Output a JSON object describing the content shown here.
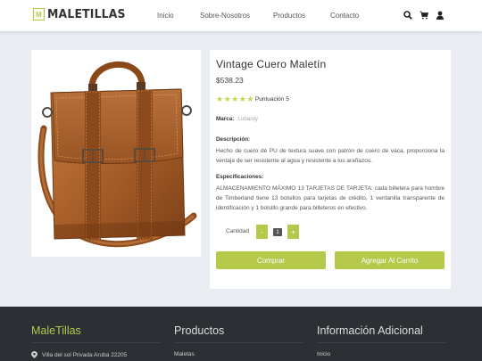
{
  "header": {
    "logo_mark": "M",
    "logo_text": "MALETILLAS",
    "nav": [
      "Inicio",
      "Sobre-Nosotros",
      "Productos",
      "Contacto"
    ],
    "icons": [
      "search-icon",
      "cart-icon",
      "user-icon"
    ]
  },
  "product": {
    "title": "Vintage Cuero Maletín",
    "price": "$538.23",
    "rating": 5,
    "rating_label": "Puntuación 5",
    "brand_label": "Marca:",
    "brand_value": "Lubardy",
    "description_label": "Descripción:",
    "description": "Hecho de cuero de PU de textura suave con patrón de cuero de vaca, proporciona la ventaja de ser resistente al agua y resistente a los arañazos.",
    "specs_label": "Especificaciones:",
    "specs": "ALMACENAMIENTO MÁXIMO 13 TARJETAS DE TARJETA: cada billetera para hombre de Timberland tiene 13 bolsillos para tarjetas de crédito, 1 ventanilla transparente de identificación y 1 bolsillo grande para billeteros en efectivo.",
    "quantity_label": "Cantidad",
    "quantity_minus": "-",
    "quantity_value": "1",
    "quantity_plus": "+",
    "buy_label": "Comprar",
    "add_cart_label": "Agregar Al Carrito"
  },
  "footer": {
    "col1_title": "MaleTillas",
    "col1_item": "Villa del sol Privada Aruba 22205",
    "col2_title": "Productos",
    "col2_item": "Maletas",
    "col3_title": "Información Adicional",
    "col3_item": "Inicio"
  },
  "colors": {
    "accent": "#b5c84a",
    "footer_bg": "#2c3035",
    "page_bg": "#e9ecf1"
  }
}
